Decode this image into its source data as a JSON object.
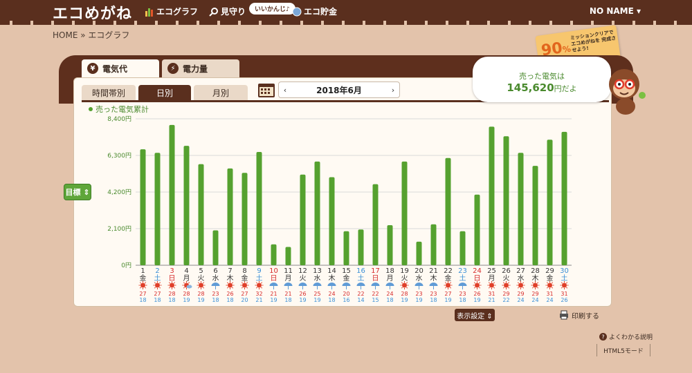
{
  "header": {
    "logo": "エコめがね",
    "nav": [
      {
        "label": "エコグラフ",
        "icon": "bar-chart-icon"
      },
      {
        "label": "見守り",
        "icon": "magnifier-icon"
      },
      {
        "label": "エコ貯金",
        "icon": "coin-icon"
      }
    ],
    "bubble": "いいかんじ♪",
    "user": "NO NAME ▾"
  },
  "breadcrumb": "HOME » エコグラフ",
  "mission": {
    "percent": "90",
    "unit": "%",
    "message": "ミッションクリアで エコめがねを 完成させよう!"
  },
  "tabs": {
    "main": [
      {
        "label": "電気代",
        "icon": "yen-icon",
        "active": true
      },
      {
        "label": "電力量",
        "icon": "bolt-icon",
        "active": false
      }
    ],
    "sub": [
      {
        "label": "時間帯別",
        "active": false
      },
      {
        "label": "日別",
        "active": true
      },
      {
        "label": "月別",
        "active": false
      }
    ],
    "period": "2018年6月",
    "prev": "‹",
    "next": "›"
  },
  "summary": {
    "line1": "売った電気は",
    "amount": "145,620",
    "unit": "円だよ"
  },
  "goal_button": "目標 ⇕",
  "footer": {
    "display_settings": "表示設定 ⇕",
    "print": "印刷する",
    "help": "よくわかる説明",
    "html5": "HTML5モード"
  },
  "chart_data": {
    "type": "bar",
    "legend": "売った電気累計",
    "ylim": [
      0,
      8400
    ],
    "yticks": [
      "8,400円",
      "6,300円",
      "4,200円",
      "2,100円",
      "0円"
    ],
    "bar_color": "#55a12f",
    "categories": [
      "1",
      "2",
      "3",
      "4",
      "5",
      "6",
      "7",
      "8",
      "9",
      "10",
      "11",
      "12",
      "13",
      "14",
      "15",
      "16",
      "17",
      "18",
      "19",
      "20",
      "21",
      "22",
      "23",
      "24",
      "25",
      "26",
      "27",
      "28",
      "29",
      "30"
    ],
    "weekdays": [
      "金",
      "土",
      "日",
      "月",
      "火",
      "水",
      "木",
      "金",
      "土",
      "日",
      "月",
      "火",
      "水",
      "木",
      "金",
      "土",
      "日",
      "月",
      "火",
      "水",
      "木",
      "金",
      "土",
      "日",
      "月",
      "火",
      "水",
      "木",
      "金",
      "土"
    ],
    "values": [
      6650,
      6450,
      8050,
      6850,
      5800,
      2000,
      5550,
      5300,
      6500,
      1200,
      1050,
      5200,
      5950,
      5050,
      1950,
      2050,
      4650,
      2300,
      5950,
      1350,
      2350,
      6150,
      1950,
      4050,
      7950,
      7400,
      6450,
      5700,
      7200,
      7650
    ],
    "weather": [
      "sun",
      "sun",
      "sun",
      "sun+cloud",
      "sun",
      "rain",
      "sun",
      "sun",
      "sun",
      "rain",
      "rain",
      "rain",
      "rain",
      "rain",
      "rain",
      "rain",
      "rain",
      "rain",
      "sun",
      "rain",
      "rain",
      "sun",
      "rain",
      "sun",
      "sun",
      "sun",
      "sun",
      "sun",
      "sun",
      "sun"
    ],
    "temp_high": [
      "27",
      "27",
      "28",
      "28",
      "28",
      "23",
      "26",
      "27",
      "32",
      "21",
      "21",
      "26",
      "25",
      "24",
      "20",
      "22",
      "22",
      "24",
      "28",
      "23",
      "23",
      "27",
      "23",
      "26",
      "31",
      "29",
      "29",
      "29",
      "31",
      "31"
    ],
    "temp_low": [
      "18",
      "18",
      "18",
      "19",
      "19",
      "18",
      "18",
      "20",
      "21",
      "19",
      "18",
      "19",
      "19",
      "18",
      "16",
      "14",
      "15",
      "18",
      "19",
      "19",
      "18",
      "19",
      "18",
      "19",
      "21",
      "22",
      "24",
      "24",
      "24",
      "26"
    ]
  }
}
